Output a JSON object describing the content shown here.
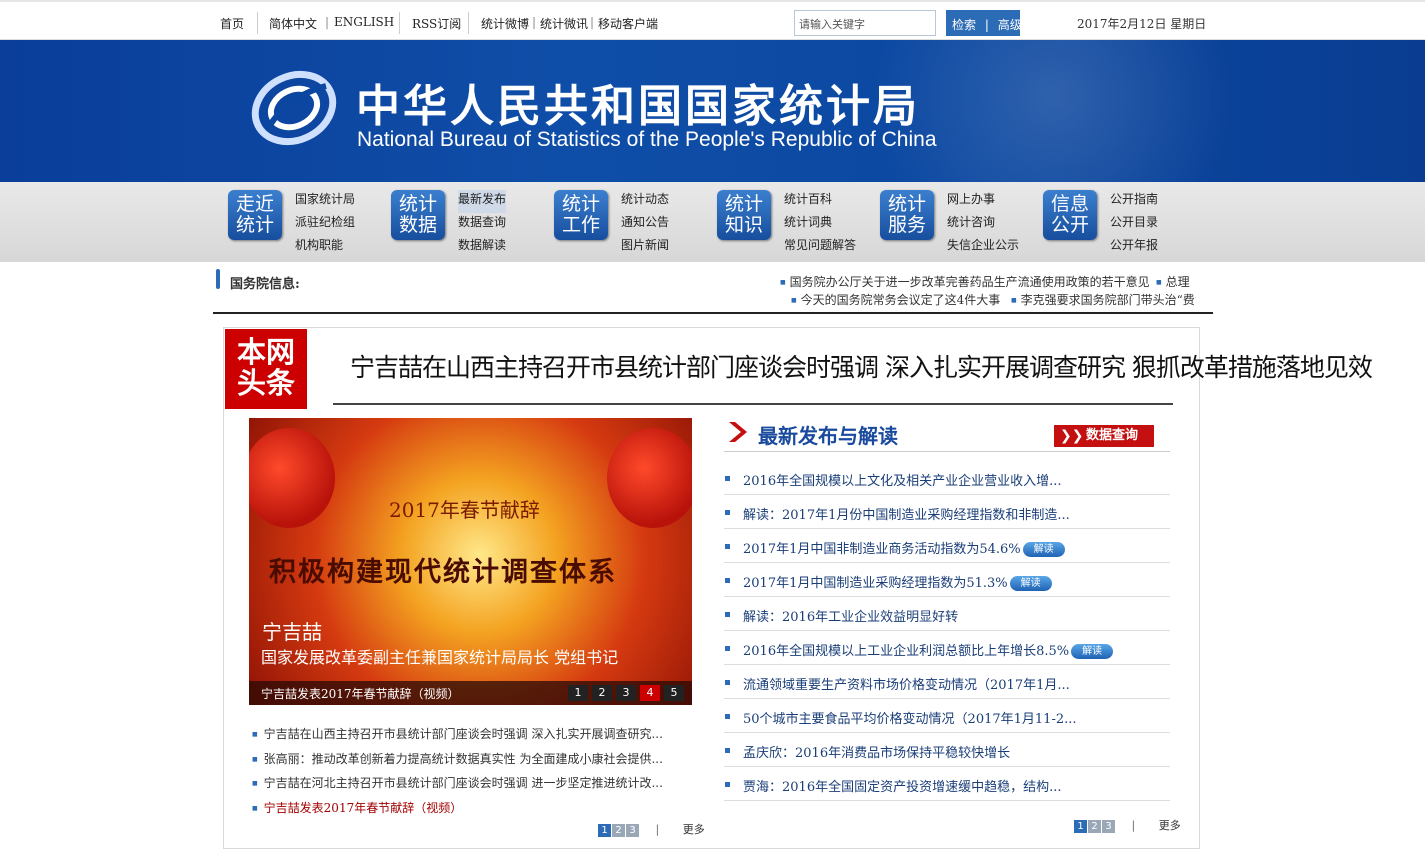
{
  "topbar": {
    "home": "首页",
    "simplified": "简体中文",
    "english": "ENGLISH",
    "rss": "RSS订阅",
    "weibo": "统计微博",
    "weixin": "统计微讯",
    "mobile": "移动客户端",
    "search_placeholder": "请输入关键字",
    "search_btn": "检索",
    "advanced_btn": "高级",
    "divider": "|",
    "date": "2017年2月12日 星期日"
  },
  "banner": {
    "title_cn": "中华人民共和国国家统计局",
    "title_en": "National Bureau of Statistics of the People's Republic of China"
  },
  "nav": [
    {
      "icon": "走近统计",
      "links": [
        "国家统计局",
        "派驻纪检组",
        "机构职能"
      ]
    },
    {
      "icon": "统计数据",
      "links": [
        "最新发布",
        "数据查询",
        "数据解读"
      ]
    },
    {
      "icon": "统计工作",
      "links": [
        "统计动态",
        "通知公告",
        "图片新闻"
      ]
    },
    {
      "icon": "统计知识",
      "links": [
        "统计百科",
        "统计词典",
        "常见问题解答"
      ]
    },
    {
      "icon": "统计服务",
      "links": [
        "网上办事",
        "统计咨询",
        "失信企业公示"
      ]
    },
    {
      "icon": "信息公开",
      "links": [
        "公开指南",
        "公开目录",
        "公开年报"
      ]
    }
  ],
  "gov": {
    "title": "国务院信息:",
    "items": [
      "国务院办公厅关于进一步改革完善药品生产流通使用政策的若干意见",
      "总理",
      "今天的国务院常务会议定了这4件大事",
      "李克强要求国务院部门带头治“费”"
    ]
  },
  "headline": {
    "tag_line1": "本网",
    "tag_line2": "头条",
    "text": "宁吉喆在山西主持召开市县统计部门座谈会时强调 深入扎实开展调查研究 狠抓改革措施落地见效"
  },
  "slide": {
    "year_title": "2017年春节献辞",
    "slogan": "积极构建现代统计调查体系",
    "name": "宁吉喆",
    "position": "国家发展改革委副主任兼国家统计局局长 党组书记",
    "caption": "宁吉喆发表2017年春节献辞（视频）",
    "pages": [
      "1",
      "2",
      "3",
      "4",
      "5"
    ],
    "active_page": 4
  },
  "left_news": [
    "宁吉喆在山西主持召开市县统计部门座谈会时强调 深入扎实开展调查研究...",
    "张高丽：推动改革创新着力提高统计数据真实性 为全面建成小康社会提供...",
    "宁吉喆在河北主持召开市县统计部门座谈会时强调 进一步坚定推进统计改...",
    "宁吉喆发表2017年春节献辞（视频）"
  ],
  "pager": {
    "pages": [
      "1",
      "2",
      "3"
    ],
    "sep": "|",
    "more": "更多"
  },
  "release": {
    "title": "最新发布与解读",
    "query_btn": "数据查询",
    "badge": "解读",
    "items": [
      {
        "text": "2016年全国规模以上文化及相关产业企业营业收入增...",
        "badge": false
      },
      {
        "text": "解读：2017年1月份中国制造业采购经理指数和非制造...",
        "badge": false
      },
      {
        "text": "2017年1月中国非制造业商务活动指数为54.6%",
        "badge": true
      },
      {
        "text": "2017年1月中国制造业采购经理指数为51.3%",
        "badge": true
      },
      {
        "text": "解读：2016年工业企业效益明显好转",
        "badge": false
      },
      {
        "text": "2016年全国规模以上工业企业利润总额比上年增长8.5%",
        "badge": true
      },
      {
        "text": "流通领域重要生产资料市场价格变动情况（2017年1月...",
        "badge": false
      },
      {
        "text": "50个城市主要食品平均价格变动情况（2017年1月11-2...",
        "badge": false
      },
      {
        "text": "孟庆欣：2016年消费品市场保持平稳较快增长",
        "badge": false
      },
      {
        "text": "贾海：2016年全国固定资产投资增速缓中趋稳，结构...",
        "badge": false
      }
    ]
  }
}
